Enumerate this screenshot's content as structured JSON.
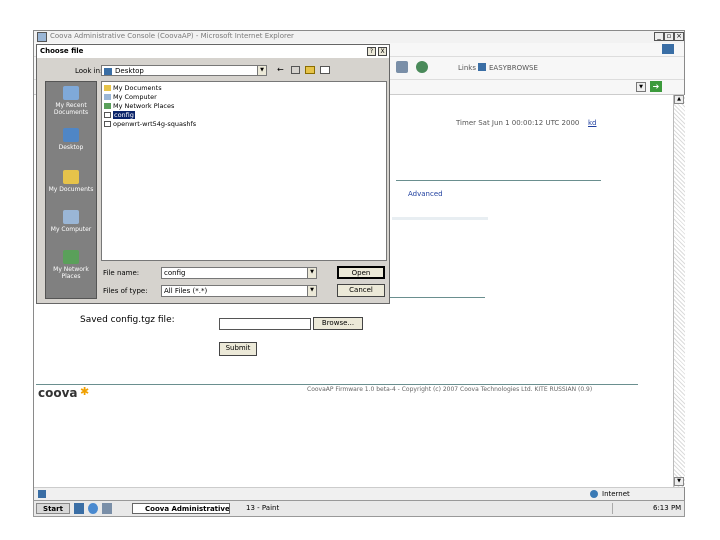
{
  "ie": {
    "title": "Coova Administrative Console (CoovaAP) - Microsoft Internet Explorer",
    "links_label": "Links",
    "links_item": "EASYBROWSE"
  },
  "page": {
    "timestamp": "Timer Sat Jun 1 00:00:12 UTC 2000",
    "timestamp_link": "kd",
    "nav_link": "Advanced",
    "saved_label": "Saved config.tgz file:",
    "browse_label": "Browse...",
    "submit_label": "Submit",
    "logo": "coova",
    "footer": "CoovaAP Firmware 1.0 beta-4 - Copyright (c) 2007 Coova Technologies Ltd. KITE RUSSIAN (0.9)"
  },
  "dialog": {
    "title": "Choose file",
    "help": "?",
    "close": "X",
    "lookin_label": "Look in:",
    "lookin_value": "Desktop",
    "places": [
      {
        "label": "My Recent Documents"
      },
      {
        "label": "Desktop"
      },
      {
        "label": "My Documents"
      },
      {
        "label": "My Computer"
      },
      {
        "label": "My Network Places"
      }
    ],
    "files": [
      {
        "name": "My Documents"
      },
      {
        "name": "My Computer"
      },
      {
        "name": "My Network Places"
      },
      {
        "name": "config"
      },
      {
        "name": "openwrt-wrt54g-squashfs"
      }
    ],
    "filename_label": "File name:",
    "filename_value": "config",
    "filetype_label": "Files of type:",
    "filetype_value": "All Files (*.*)",
    "open_label": "Open",
    "cancel_label": "Cancel"
  },
  "status": {
    "zone": "Internet"
  },
  "taskbar": {
    "start": "Start",
    "task1": "Coova Administrative...",
    "task2": "13 - Paint",
    "clock": "6:13 PM"
  },
  "colors": {
    "selection": "#0a246a",
    "places_bg": "#808080",
    "rule": "#6a8f8f",
    "logo_star": "#f0a000"
  }
}
